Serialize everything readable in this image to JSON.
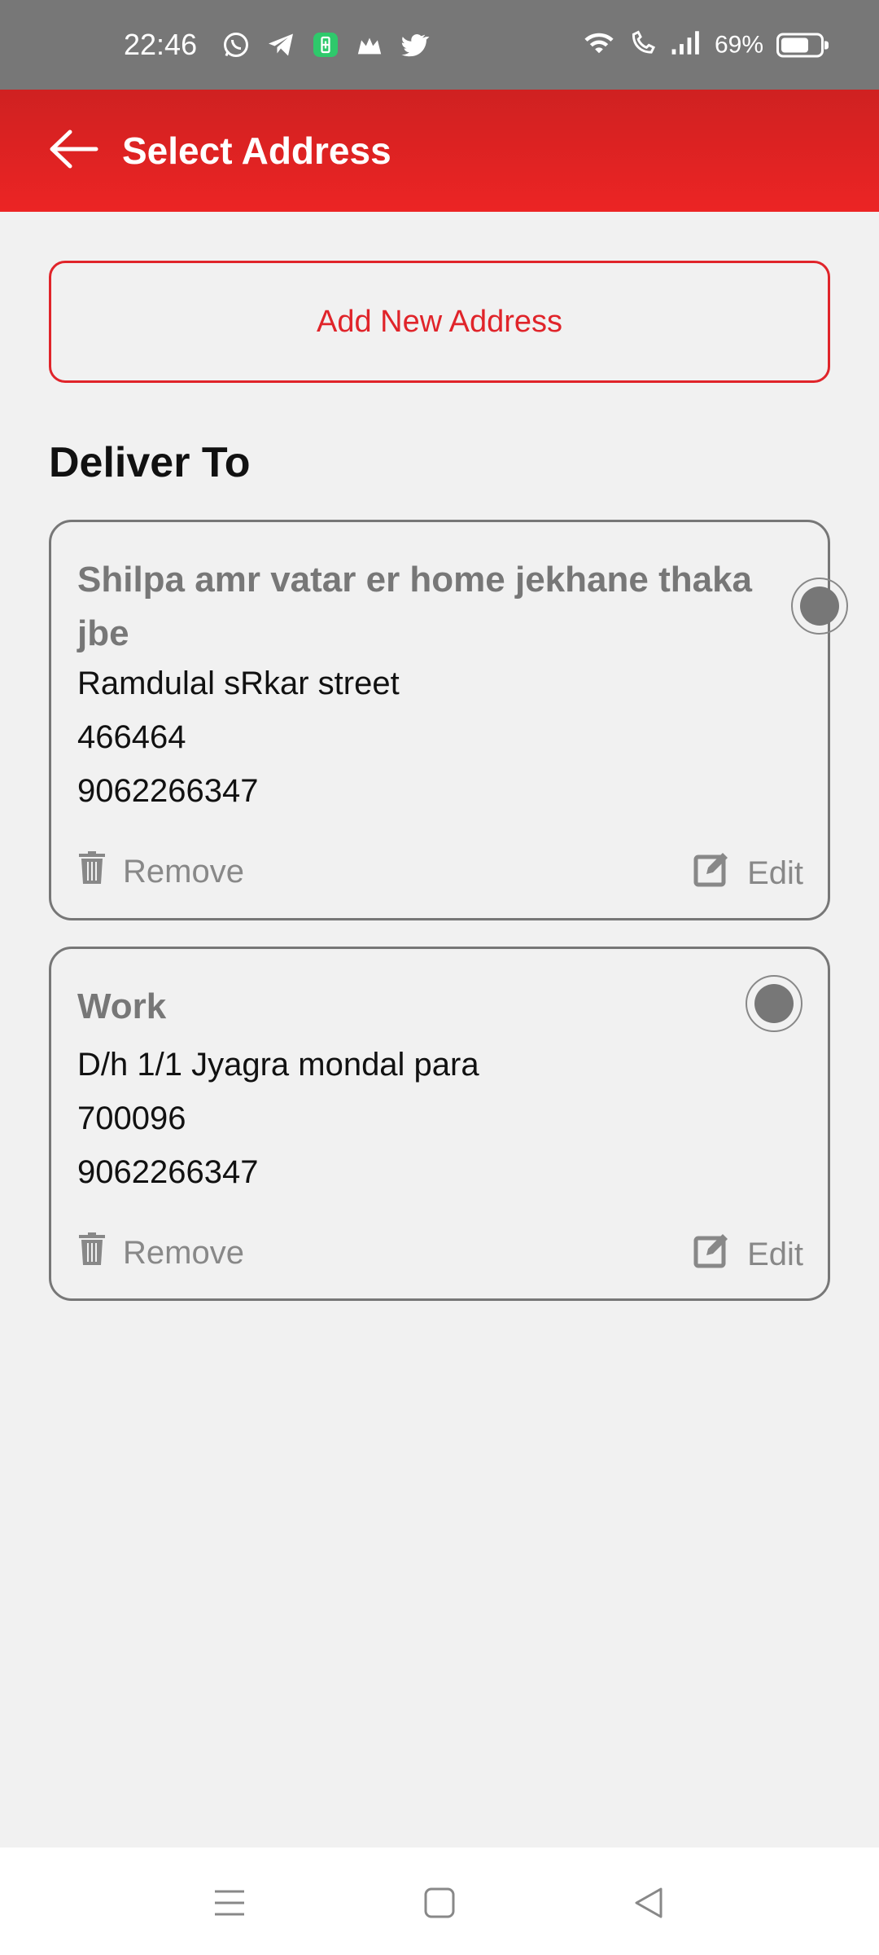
{
  "status_bar": {
    "time": "22:46",
    "battery_percent": "69%",
    "battery_level": 0.69,
    "app_icons": [
      "whatsapp-icon",
      "telegram-icon",
      "battery-saver-icon",
      "crown-icon",
      "twitter-icon"
    ],
    "right_icons": [
      "wifi-icon",
      "wifi-call-icon",
      "signal-icon",
      "battery-icon"
    ]
  },
  "header": {
    "title": "Select Address",
    "back_icon": "arrow-left-icon"
  },
  "add_address": {
    "label": "Add New Address"
  },
  "section": {
    "title": "Deliver To"
  },
  "addresses": [
    {
      "name": "Shilpa amr vatar er home jekhane thaka jbe",
      "street": "Ramdulal sRkar street",
      "pincode": "466464",
      "phone": "9062266347",
      "remove_label": "Remove",
      "edit_label": "Edit"
    },
    {
      "name": "Work",
      "street": "D/h 1/1 Jyagra mondal para",
      "pincode": "700096",
      "phone": "9062266347",
      "remove_label": "Remove",
      "edit_label": "Edit"
    }
  ],
  "colors": {
    "primary": "#e0242a",
    "status_bar": "#777777",
    "background": "#f1f1f1",
    "muted_text": "#777777"
  },
  "nav_icons": [
    "menu-icon",
    "home-square-icon",
    "back-triangle-icon"
  ]
}
